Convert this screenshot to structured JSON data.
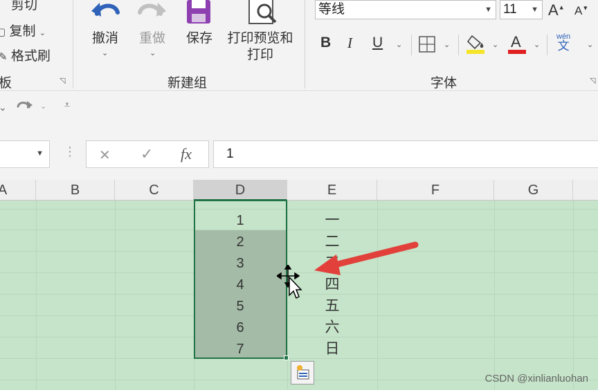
{
  "clipboard": {
    "cut_label": "剪切",
    "copy_label": "复制",
    "format_painter_label": "格式刷",
    "group_label": "板"
  },
  "newgroup": {
    "undo_label": "撤消",
    "redo_label": "重做",
    "save_label": "保存",
    "print_preview_label_line1": "打印预览和",
    "print_preview_label_line2": "打印",
    "group_label": "新建组"
  },
  "font": {
    "name": "等线",
    "size": "11",
    "bold": "B",
    "italic": "I",
    "underline": "U",
    "grow": "A",
    "shrink": "A",
    "group_label": "字体",
    "wen_label": "wén",
    "wen_char": "文",
    "fill_color": "#f5e52a",
    "font_color": "#e02020"
  },
  "formula_bar": {
    "cancel": "✕",
    "enter": "✓",
    "fx": "fx",
    "value": "1"
  },
  "columns": [
    "A",
    "B",
    "C",
    "D",
    "E",
    "F",
    "G"
  ],
  "column_d_values": [
    "1",
    "2",
    "3",
    "4",
    "5",
    "6",
    "7"
  ],
  "column_e_values": [
    "一",
    "二",
    "三",
    "四",
    "五",
    "六",
    "日"
  ],
  "watermark": "CSDN @xinlianluohan",
  "selection_color": "#a4bca7",
  "accent_green": "#217346",
  "arrow_color": "#e2403a"
}
